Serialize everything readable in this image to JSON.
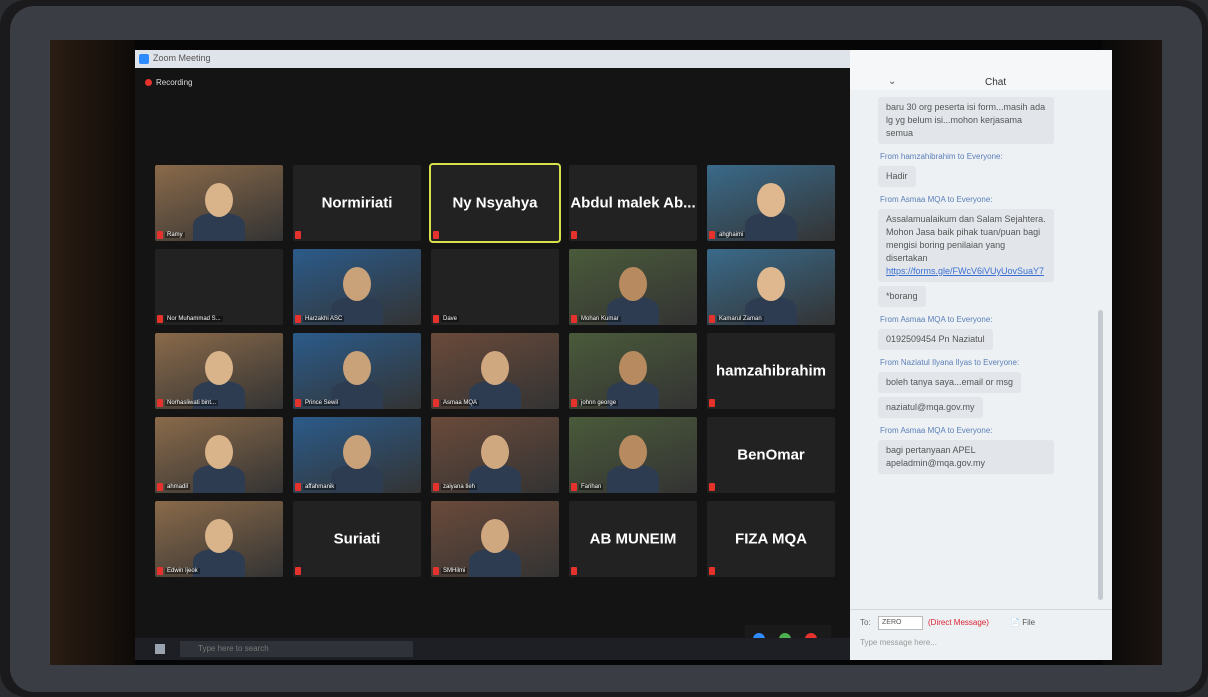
{
  "window": {
    "title": "Zoom Meeting",
    "recording_label": "Recording"
  },
  "tiles": [
    {
      "name": "",
      "label": "Ramy",
      "kind": "video"
    },
    {
      "name": "Normiriati",
      "label": "",
      "kind": "name"
    },
    {
      "name": "Ny Nsyahya",
      "label": "",
      "kind": "name",
      "active": true
    },
    {
      "name": "Abdul malek Ab...",
      "label": "",
      "kind": "name"
    },
    {
      "name": "",
      "label": "ahghaimi",
      "kind": "video"
    },
    {
      "name": "",
      "label": "Nor Muhammad S...",
      "kind": "blank"
    },
    {
      "name": "",
      "label": "Harzakhi ASC",
      "kind": "video"
    },
    {
      "name": "",
      "label": "Dave",
      "kind": "blank"
    },
    {
      "name": "",
      "label": "Mohan Kumar",
      "kind": "video"
    },
    {
      "name": "",
      "label": "Kamarul Zaman",
      "kind": "video"
    },
    {
      "name": "",
      "label": "Norhasliwati bint...",
      "kind": "video"
    },
    {
      "name": "",
      "label": "Prince Sewil",
      "kind": "video"
    },
    {
      "name": "",
      "label": "Asmaa MQA",
      "kind": "video"
    },
    {
      "name": "",
      "label": "johnn george",
      "kind": "video"
    },
    {
      "name": "hamzahibrahim",
      "label": "",
      "kind": "name"
    },
    {
      "name": "",
      "label": "ahmadil",
      "kind": "video"
    },
    {
      "name": "",
      "label": "affahmanik",
      "kind": "video"
    },
    {
      "name": "",
      "label": "zaiyana tieh",
      "kind": "video"
    },
    {
      "name": "",
      "label": "Farihan",
      "kind": "video"
    },
    {
      "name": "BenOmar",
      "label": "",
      "kind": "name"
    },
    {
      "name": "",
      "label": "Edwin Ijeok",
      "kind": "video"
    },
    {
      "name": "Suriati",
      "label": "",
      "kind": "name"
    },
    {
      "name": "",
      "label": "SMHilmi",
      "kind": "video"
    },
    {
      "name": "AB MUNEIM",
      "label": "",
      "kind": "name"
    },
    {
      "name": "FIZA MQA",
      "label": "",
      "kind": "name"
    }
  ],
  "taskbar": {
    "search_placeholder": "Type here to search"
  },
  "chat": {
    "title": "Chat",
    "messages": [
      {
        "meta": "",
        "text": "baru 30 org peserta isi form...masih ada lg yg belum isi...mohon kerjasama semua"
      },
      {
        "meta": "From hamzahibrahim to Everyone:",
        "text": "Hadir"
      },
      {
        "meta": "From Asmaa MQA to Everyone:",
        "text": "Assalamualaikum dan Salam Sejahtera. Mohon Jasa baik pihak tuan/puan bagi mengisi boring penilaian yang disertakan",
        "link": "https://forms.gle/FWcV6iVUyUovSuaY7"
      },
      {
        "meta": "",
        "text": "*borang"
      },
      {
        "meta": "From Asmaa MQA to Everyone:",
        "text": "0192509454 Pn Naziatul"
      },
      {
        "meta": "From Naziatul Ilyana Ilyas to Everyone:",
        "text": "boleh tanya saya...email or msg"
      },
      {
        "meta": "",
        "text": "naziatul@mqa.gov.my"
      },
      {
        "meta": "From Asmaa MQA to Everyone:",
        "text": "bagi pertanyaan APEL apeladmin@mqa.gov.my"
      }
    ],
    "to_label": "To:",
    "to_value": "ZERO",
    "direct_message": "(Direct Message)",
    "file_label": "File",
    "input_placeholder": "Type message here..."
  }
}
